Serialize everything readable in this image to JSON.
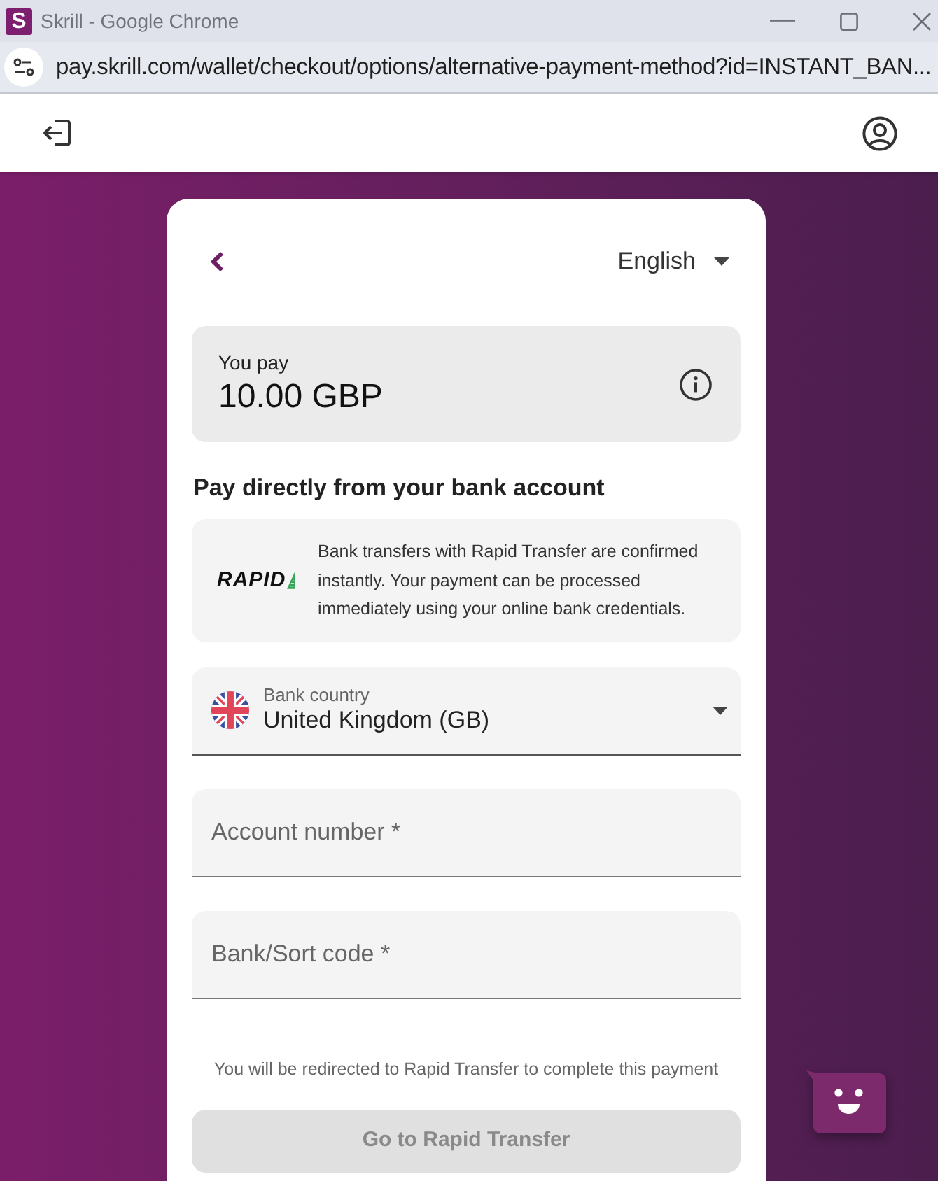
{
  "browser": {
    "favicon_letter": "S",
    "title": "Skrill - Google Chrome",
    "url": "pay.skrill.com/wallet/checkout/options/alternative-payment-method?id=INSTANT_BAN..."
  },
  "checkout": {
    "language": "English",
    "payment": {
      "label": "You pay",
      "amount": "10.00 GBP"
    },
    "heading": "Pay directly from your bank account",
    "method": {
      "logo_text": "RAPID",
      "description": "Bank transfers with Rapid Transfer are confirmed instantly. Your payment can be processed immediately using your online bank credentials."
    },
    "fields": [
      {
        "kind": "select",
        "label": "Bank country",
        "value": "United Kingdom (GB)"
      },
      {
        "kind": "text",
        "placeholder": "Account number *"
      },
      {
        "kind": "text",
        "placeholder": "Bank/Sort code *"
      }
    ],
    "note": "You will be redirected to Rapid Transfer to complete this payment",
    "submit": {
      "label": "Go to Rapid Transfer",
      "disabled": true
    }
  }
}
